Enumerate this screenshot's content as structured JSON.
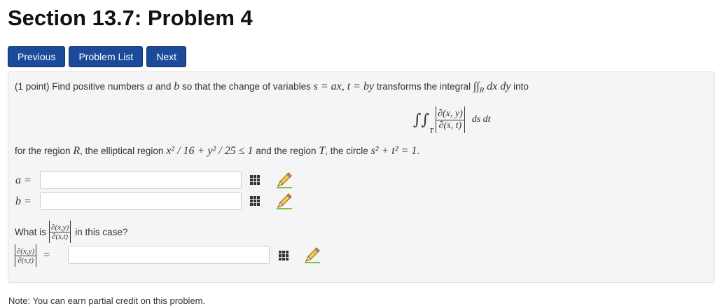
{
  "page": {
    "title": "Section 13.7: Problem 4"
  },
  "nav": {
    "previous": "Previous",
    "problem_list": "Problem List",
    "next": "Next"
  },
  "problem": {
    "points": "(1 point)",
    "intro": "Find positive numbers",
    "a": "a",
    "and": "and",
    "b": "b",
    "so_that": "so that the change of variables",
    "sub_1": "s = ax, t = by",
    "transforms": "transforms the integral",
    "integral_1": "∫∫",
    "region_R_sub": "R",
    "dx_dy": "dx dy",
    "into": "into",
    "display_integral": "∫∫",
    "region_T_sub": "T",
    "jac_num": "∂(x, y)",
    "jac_den": "∂(s, t)",
    "ds_dt": "ds dt",
    "for_region": "for the region",
    "R": "R",
    "elliptical": ", the elliptical region",
    "ellipse_eq": "x² / 16 + y² / 25 ≤ 1",
    "and_region": "and the region",
    "T": "T",
    "circle_text": ", the circle",
    "circle_eq": "s² + t² = 1",
    "period": "."
  },
  "answers": {
    "a_label": "a =",
    "b_label": "b =",
    "a_value": "",
    "b_value": "",
    "what_is": "What is",
    "in_this_case": "in this case?",
    "small_num": "∂(x,y)",
    "small_den": "∂(s,t)",
    "eq": "=",
    "jac_value": ""
  },
  "footer": {
    "note": "Note: You can earn partial credit on this problem."
  },
  "icons": {
    "matrix": "matrix-grid-icon",
    "pencil": "pencil-icon"
  }
}
